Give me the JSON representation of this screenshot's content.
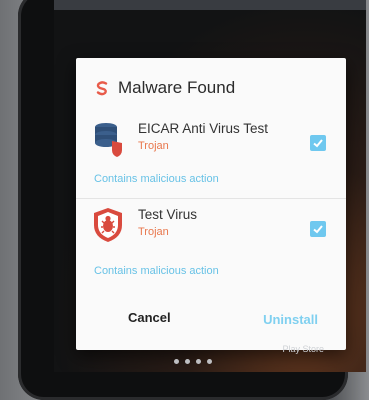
{
  "dialog": {
    "title": "Malware Found",
    "items": [
      {
        "name": "EICAR Anti Virus Test",
        "type": "Trojan",
        "description": "Contains malicious action",
        "icon": "database-shield-icon",
        "checked": true
      },
      {
        "name": "Test Virus",
        "type": "Trojan",
        "description": "Contains malicious action",
        "icon": "bug-shield-icon",
        "checked": true
      }
    ],
    "cancel_label": "Cancel",
    "uninstall_label": "Uninstall"
  },
  "homescreen": {
    "play_store_label": "Play Store"
  },
  "colors": {
    "accent": "#6fc8ef",
    "trojan": "#e8774d",
    "desc": "#68c2e6",
    "brand": "#e85b4a"
  }
}
